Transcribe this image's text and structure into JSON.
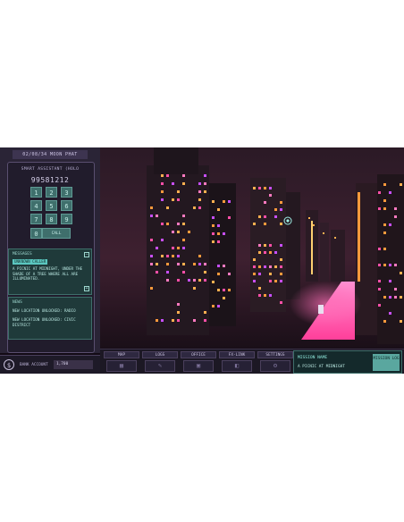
{
  "header": {
    "date": "02/08/34 MOON PHAT"
  },
  "phone": {
    "title": "SMART ASSISTANT (HOLO",
    "display": "99581212",
    "keys": [
      "1",
      "2",
      "3",
      "4",
      "5",
      "6",
      "7",
      "8",
      "9",
      "0"
    ],
    "call_label": "CALL"
  },
  "messages": {
    "title": "MESSAGES",
    "collapse": "−",
    "expand": "+",
    "from": "UNKNOWN CALLER",
    "body": "A PICNIC AT MIDNIGHT, UNDER THE SHADE OF A TREE WHERE ALL ARE ILLUMINATED."
  },
  "news": {
    "title": "NEWS",
    "items": [
      "NEW LOCATION UNLOCKED: RADIO",
      "NEW LOCATION UNLOCKED: CIVIC DISTRICT"
    ]
  },
  "bank": {
    "icon": "dollar-coin-icon",
    "label": "BANK ACCOUNT",
    "value": "1,700"
  },
  "nav": [
    {
      "label": "MAP",
      "icon": "map-icon"
    },
    {
      "label": "LOGS",
      "icon": "logs-icon"
    },
    {
      "label": "OFFICE",
      "icon": "office-icon"
    },
    {
      "label": "FX-LINK",
      "icon": "fx-link-icon"
    },
    {
      "label": "SETTINGS",
      "icon": "settings-icon"
    }
  ],
  "mission": {
    "label": "MISSION NAME",
    "name": "A PICNIC AT MIDNIGHT",
    "button": "MISSION LOG"
  },
  "colors": {
    "accent": "#5bc7c0",
    "panel": "#2a2436",
    "neon_pink": "#ff4fa8",
    "neon_orange": "#ff9a3c"
  }
}
